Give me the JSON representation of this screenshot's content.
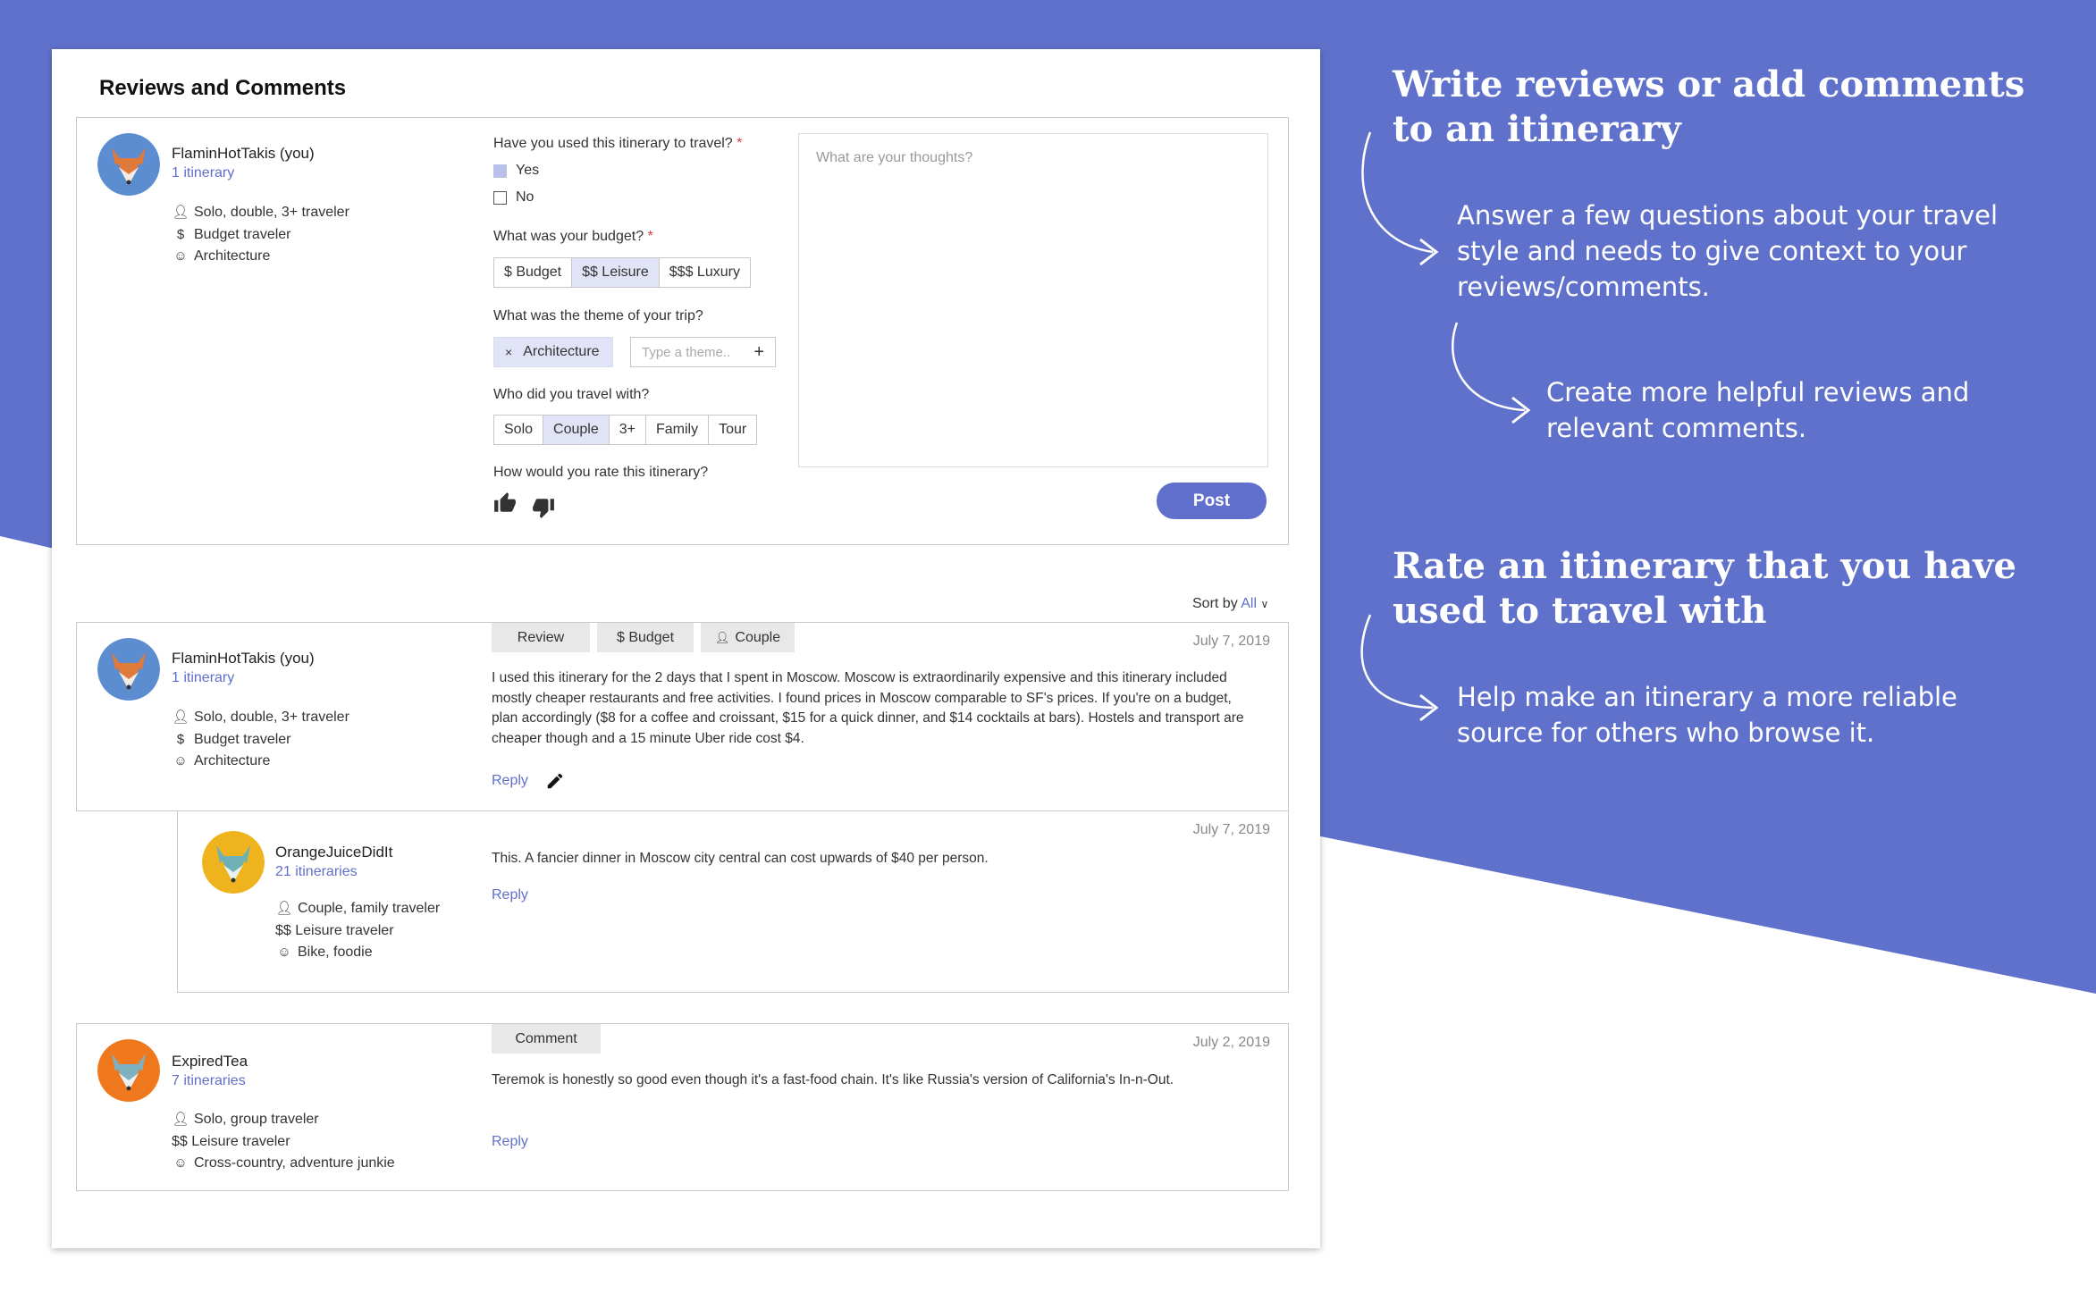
{
  "colors": {
    "accent": "#5f6fcb",
    "chip": "#e1e4f6",
    "tag": "#e8e8e8"
  },
  "section_title": "Reviews and Comments",
  "composer": {
    "user": {
      "name": "FlaminHotTakis (you)",
      "link": "1 itinerary",
      "style": "Solo, double, 3+ traveler",
      "budget": "Budget traveler",
      "interests": "Architecture",
      "avatar": "fox-avatar"
    },
    "q_used": "Have you used this itinerary to travel?",
    "required_mark": "*",
    "opt_yes": "Yes",
    "opt_no": "No",
    "used_selected": "Yes",
    "q_budget": "What was your budget?",
    "budget_options": [
      "$ Budget",
      "$$ Leisure",
      "$$$ Luxury"
    ],
    "budget_selected": "$$ Leisure",
    "q_theme": "What was the theme of your trip?",
    "theme_chip": "Architecture",
    "theme_chip_remove": "×",
    "theme_add": "+",
    "theme_placeholder": "Type a theme..",
    "q_with": "Who did you travel with?",
    "with_options": [
      "Solo",
      "Couple",
      "3+",
      "Family",
      "Tour"
    ],
    "with_selected": "Couple",
    "q_rate": "How would you rate this itinerary?",
    "textarea_placeholder": "What are your thoughts?",
    "post": "Post"
  },
  "sort": {
    "label": "Sort by",
    "value": "All"
  },
  "reviews": [
    {
      "user": {
        "name": "FlaminHotTakis (you)",
        "link": "1 itinerary",
        "style": "Solo, double, 3+ traveler",
        "budget": "Budget traveler",
        "interests": "Architecture"
      },
      "tags": [
        "Review",
        "$ Budget",
        "Couple"
      ],
      "date": "July 7, 2019",
      "text": "I used this itinerary for the 2 days that I spent in Moscow. Moscow is extraordinarily expensive and this itinerary included mostly cheaper restaurants and free activities. I found prices in Moscow comparable to SF's prices. If you're on a budget, plan accordingly ($8 for a coffee and croissant, $15 for a quick dinner, and $14 cocktails at bars). Hostels and transport are cheaper though and a 15 minute Uber ride cost $4.",
      "reply": "Reply"
    },
    {
      "user": {
        "name": "OrangeJuiceDidIt",
        "link": "21 itineraries",
        "style": "Couple, family traveler",
        "budget": "$$ Leisure traveler",
        "interests": "Bike, foodie"
      },
      "date": "July 7, 2019",
      "text": "This. A fancier dinner in Moscow city central can cost upwards of $40 per person.",
      "reply": "Reply"
    },
    {
      "user": {
        "name": "ExpiredTea",
        "link": "7 itineraries",
        "style": "Solo, group traveler",
        "budget": "$$ Leisure traveler",
        "interests": "Cross-country, adventure junkie"
      },
      "tags": [
        "Comment"
      ],
      "date": "July 2, 2019",
      "text": "Teremok is honestly so good even though it's a fast-food chain. It's like Russia's version of California's In-n-Out.",
      "reply": "Reply"
    }
  ],
  "callouts": {
    "h1": "Write reviews or add comments to an itinerary",
    "s1": "Answer a few questions about your travel style and needs to give context to your reviews/comments.",
    "s2": "Create more helpful reviews and relevant comments.",
    "h2": "Rate an itinerary that you have used to travel with",
    "s3": "Help make an itinerary a more reliable source for others who browse it."
  }
}
